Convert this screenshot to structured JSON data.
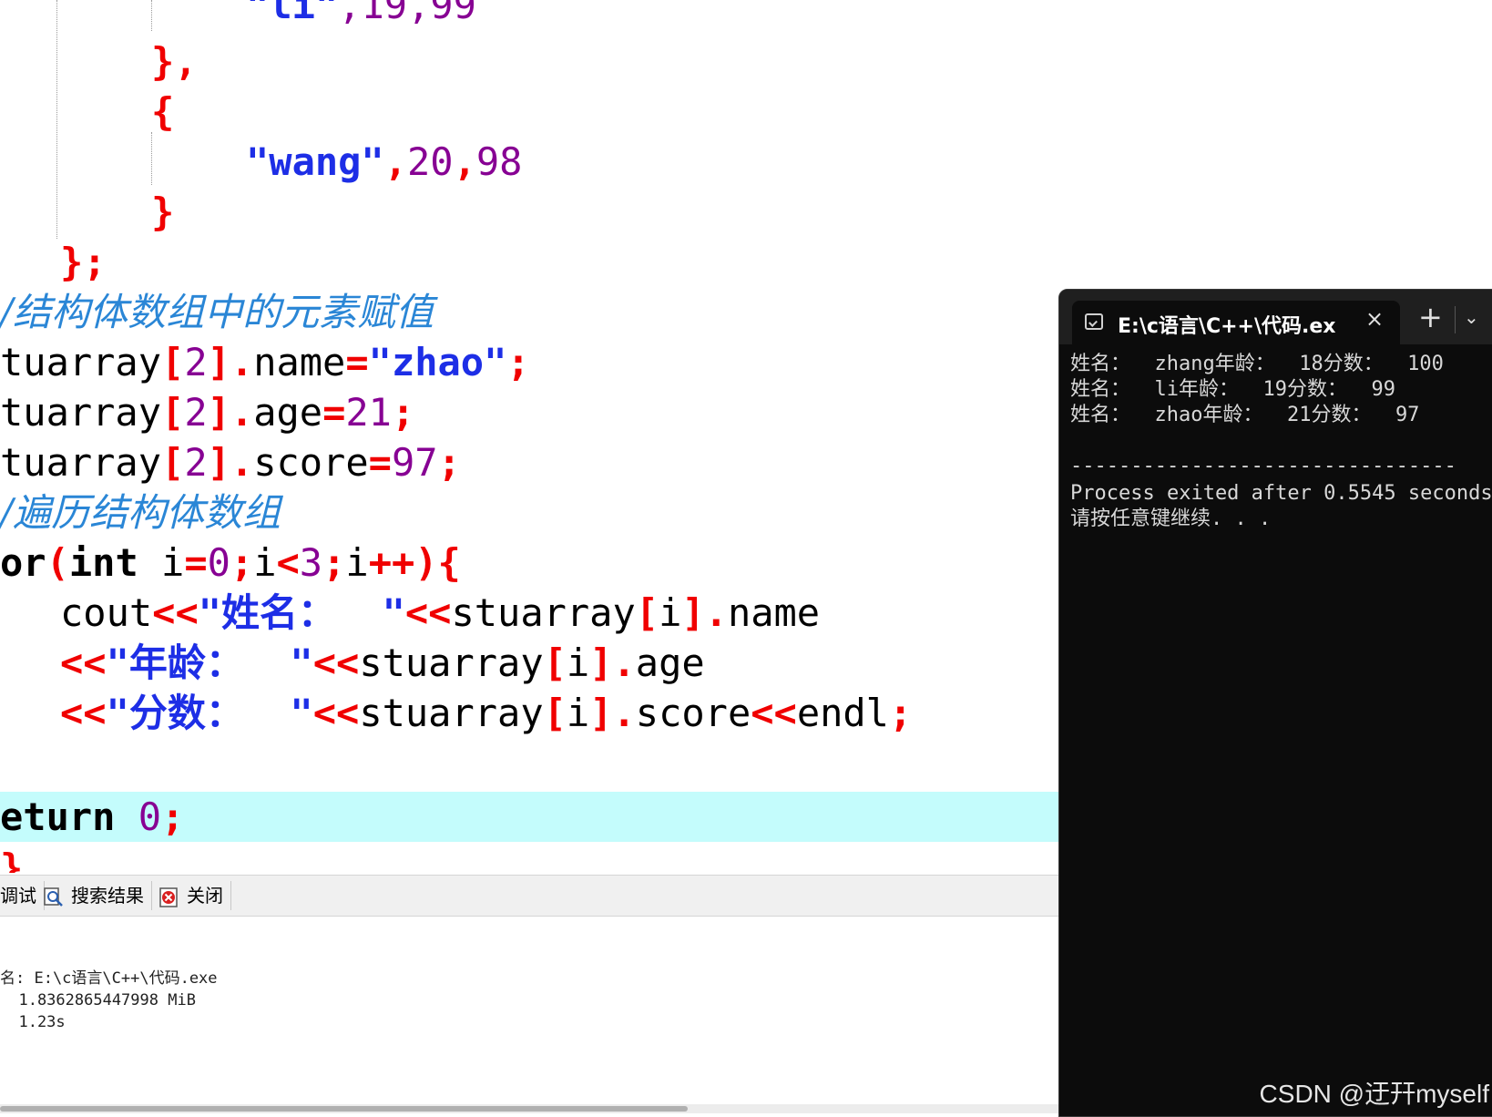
{
  "editor": {
    "lines": {
      "l1": {
        "str": "\"li\"",
        "rest": ",19,99"
      },
      "l2": "},",
      "l3": "{",
      "l4": {
        "str": "\"wang\"",
        "comma1": ",",
        "n1": "20",
        "comma2": ",",
        "n2": "98"
      },
      "l5": "}",
      "l6": "};",
      "l7": "/结构体数组中的元素赋值",
      "l8": {
        "id": "tuarray",
        "lb": "[",
        "idx": "2",
        "rb": "]",
        "dot": ".",
        "field": "name",
        "eq": "=",
        "val": "\"zhao\"",
        "semi": ";"
      },
      "l9": {
        "id": "tuarray",
        "lb": "[",
        "idx": "2",
        "rb": "]",
        "dot": ".",
        "field": "age",
        "eq": "=",
        "val": "21",
        "semi": ";"
      },
      "l10": {
        "id": "tuarray",
        "lb": "[",
        "idx": "2",
        "rb": "]",
        "dot": ".",
        "field": "score",
        "eq": "=",
        "val": "97",
        "semi": ";"
      },
      "l11": "/遍历结构体数组",
      "l12": {
        "a": "or",
        "b": "(",
        "c": "int",
        "d": " i",
        "e": "=",
        "f": "0",
        "g": ";",
        "h": "i",
        "i": "<",
        "j": "3",
        "k": ";",
        "l": "i",
        "m": "++",
        "n": "){"
      },
      "l13": {
        "a": "cout",
        "b": "<<",
        "c": "\"姓名：  \"",
        "d": "<<",
        "e": "stuarray",
        "f": "[",
        "g": "i",
        "h": "]",
        "i": ".",
        "j": "name"
      },
      "l14": {
        "b": "<<",
        "c": "\"年龄：  \"",
        "d": "<<",
        "e": "stuarray",
        "f": "[",
        "g": "i",
        "h": "]",
        "i": ".",
        "j": "age"
      },
      "l15": {
        "b": "<<",
        "c": "\"分数：  \"",
        "d": "<<",
        "e": "stuarray",
        "f": "[",
        "g": "i",
        "h": "]",
        "i": ".",
        "j": "score",
        "k": "<<",
        "l": "endl",
        "m": ";"
      },
      "l16": {
        "kw": "eturn",
        "val": "0",
        "semi": ";"
      },
      "l17": "}"
    }
  },
  "panel": {
    "tabs": {
      "debug": "调试",
      "search": "搜索结果",
      "close": "关闭"
    },
    "log": {
      "output": "名: E:\\c语言\\C++\\代码.exe",
      "size": "  1.8362865447998 MiB",
      "time": "  1.23s"
    }
  },
  "terminal": {
    "title": "E:\\c语言\\C++\\代码.ex",
    "close": "×",
    "plus": "+",
    "dropdown": "⌄",
    "output": [
      "姓名：  zhang年龄：  18分数：  100",
      "姓名：  li年龄：  19分数：  99",
      "姓名：  zhao年龄：  21分数：  97",
      "",
      "--------------------------------",
      "Process exited after 0.5545 seconds",
      "请按任意键继续. . ."
    ],
    "watermark": "CSDN @迂幵myself"
  },
  "colors": {
    "terminal_bg": "#0c0c0c",
    "highlight_line": "#c4fcfc",
    "keyword_red": "#f00000",
    "string_blue": "#1d2ee6",
    "number_purple": "#870093",
    "comment_blue": "#2a86d6"
  },
  "icons": {
    "terminal": "console-icon",
    "search": "magnifier-icon",
    "close": "close-red-icon"
  }
}
